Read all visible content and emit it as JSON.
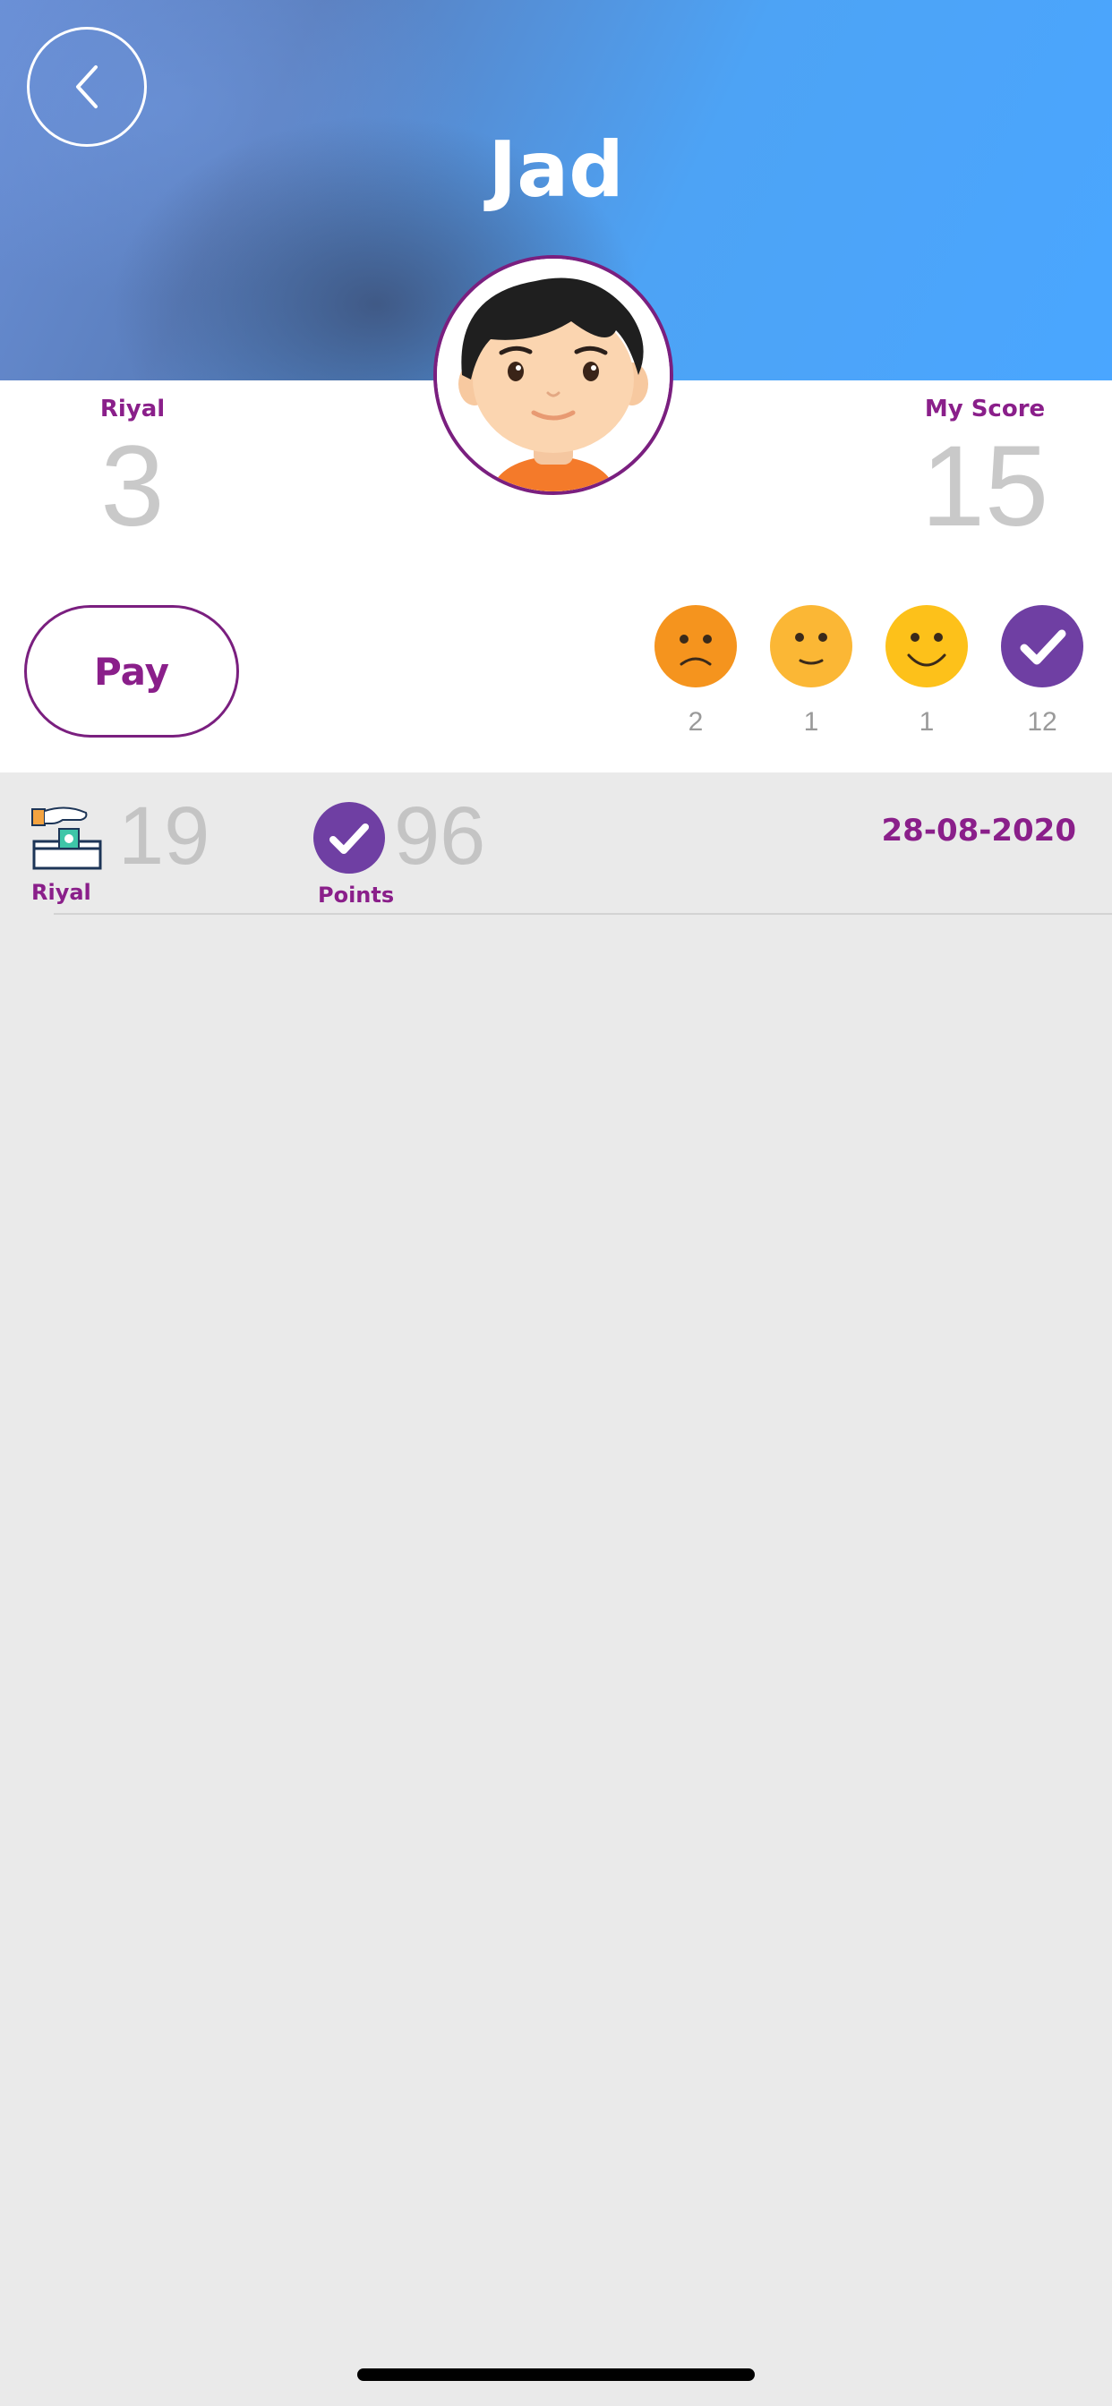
{
  "header": {
    "title": "Jad",
    "back_icon": "chevron-left-icon"
  },
  "stats": {
    "riyal_label": "Riyal",
    "riyal_value": "3",
    "score_label": "My Score",
    "score_value": "15"
  },
  "pay_button": {
    "label": "Pay"
  },
  "moods": [
    {
      "icon": "sad-face-icon",
      "count": "2",
      "color": "#f5941e"
    },
    {
      "icon": "neutral-face-icon",
      "count": "1",
      "color": "#fbb735"
    },
    {
      "icon": "happy-face-icon",
      "count": "1",
      "color": "#fdc11a"
    },
    {
      "icon": "check-icon",
      "count": "12",
      "color": "#6f3fa3"
    }
  ],
  "summary": {
    "riyal_icon": "donate-money-icon",
    "riyal_value": "19",
    "riyal_label": "Riyal",
    "points_icon": "check-icon",
    "points_value": "96",
    "points_label": "Points",
    "date": "28-08-2020"
  },
  "colors": {
    "brand_purple": "#8a1f8a",
    "check_purple": "#6f3fa3",
    "header_blue": "#4aa6ff"
  }
}
